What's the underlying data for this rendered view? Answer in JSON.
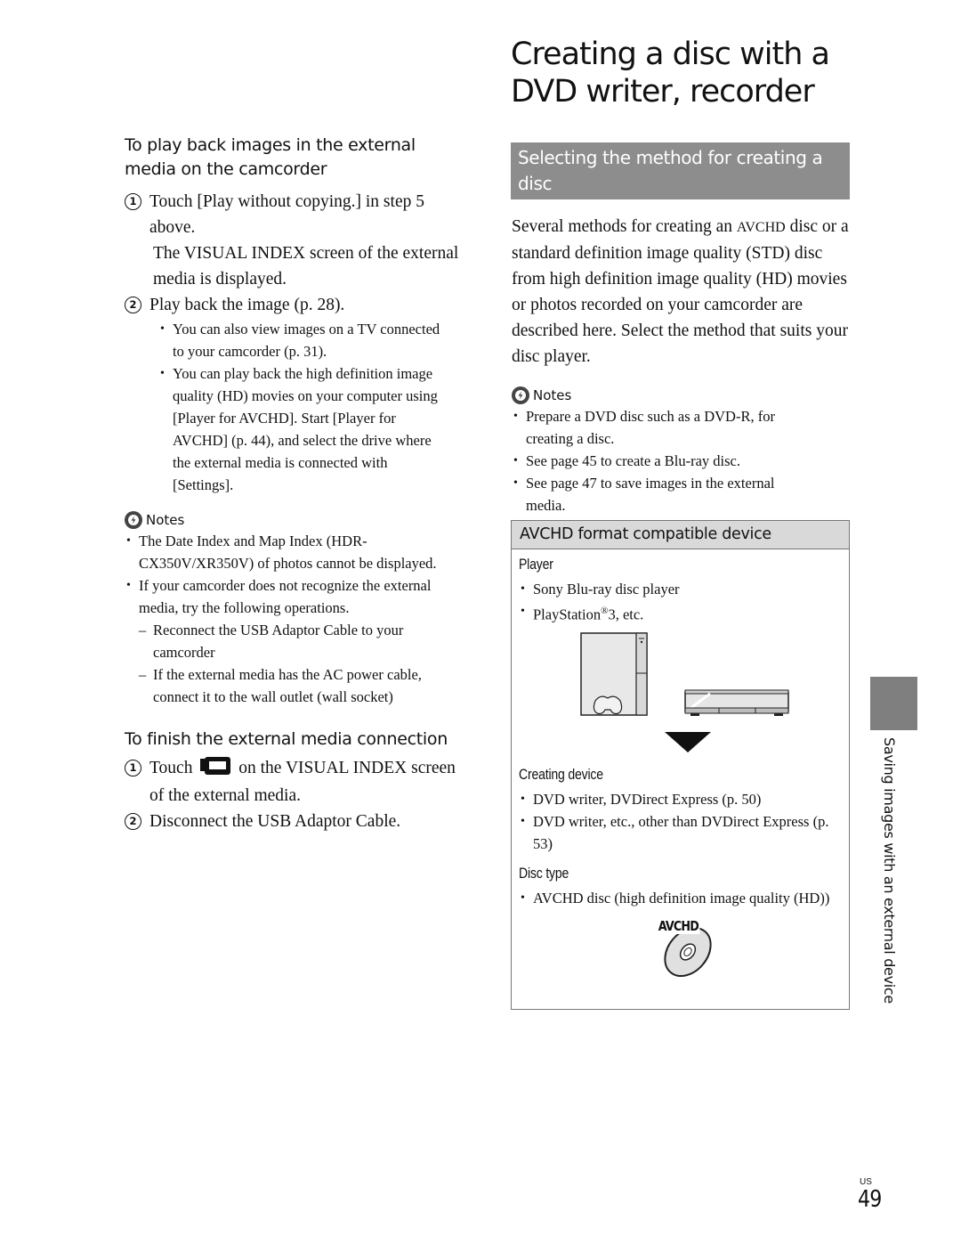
{
  "page": {
    "title": "Creating a disc with a DVD writer, recorder",
    "side_tab_label": "Saving images with an external device",
    "page_region": "US",
    "page_number": "49"
  },
  "left": {
    "playback": {
      "heading": "To play back images in the external media on the camcorder",
      "steps": [
        {
          "num": "1",
          "text": "Touch [Play without copying.] in step 5 above.",
          "note": "The VISUAL INDEX screen of the external media is displayed."
        },
        {
          "num": "2",
          "text": "Play back the image (p. 28)."
        }
      ],
      "bullets": [
        "You can also view images on a TV connected to your camcorder (p. 31).",
        "You can play back the high definition image quality (HD) movies on your computer using [Player for AVCHD]. Start [Player for AVCHD] (p. 44), and select the drive where the external media is connected with [Settings]."
      ]
    },
    "notes": {
      "label": "Notes",
      "icon": "notes-caution-icon",
      "items": [
        "The Date Index and Map Index (HDR-CX350V/XR350V) of photos cannot be displayed.",
        "If your camcorder does not recognize the external media, try the following operations."
      ],
      "sub_items": [
        "Reconnect the USB Adaptor Cable to your camcorder",
        "If the external media has the AC power cable, connect it to the wall outlet (wall socket)"
      ]
    },
    "finish": {
      "heading": "To finish the external media connection",
      "step1_prefix": "Touch",
      "step1_icon": "camcorder-mode-icon",
      "step1_suffix": "on the VISUAL INDEX screen of the external media.",
      "step2": "Disconnect the USB Adaptor Cable.",
      "nums": [
        "1",
        "2"
      ]
    }
  },
  "right": {
    "section_title": "Selecting the method for creating a disc",
    "intro_before": "Several methods for creating an ",
    "intro_sc": "AVCHD",
    "intro_after": " disc or a standard definition image quality (STD) disc from high definition image quality (HD) movies or photos recorded on your camcorder are described here. Select the method that suits your disc player.",
    "notes": {
      "label": "Notes",
      "items": [
        "Prepare a DVD disc such as a DVD-R, for creating a disc.",
        "See page 45 to create a Blu-ray disc.",
        "See page 47 to save images in the external media."
      ]
    },
    "box": {
      "heading": "AVCHD format compatible device",
      "player_label": "Player",
      "player_items": [
        "Sony Blu-ray disc player"
      ],
      "ps3_before": "PlayStation",
      "ps3_reg": "®",
      "ps3_after": "3, etc.",
      "creating_label": "Creating device",
      "creating_items": [
        "DVD writer, DVDirect Express (p. 50)",
        "DVD writer, etc., other than DVDirect Express (p. 53)"
      ],
      "disc_label": "Disc type",
      "disc_items": [
        "AVCHD disc (high definition image quality (HD))"
      ],
      "logo_text": "AVCHD"
    }
  }
}
